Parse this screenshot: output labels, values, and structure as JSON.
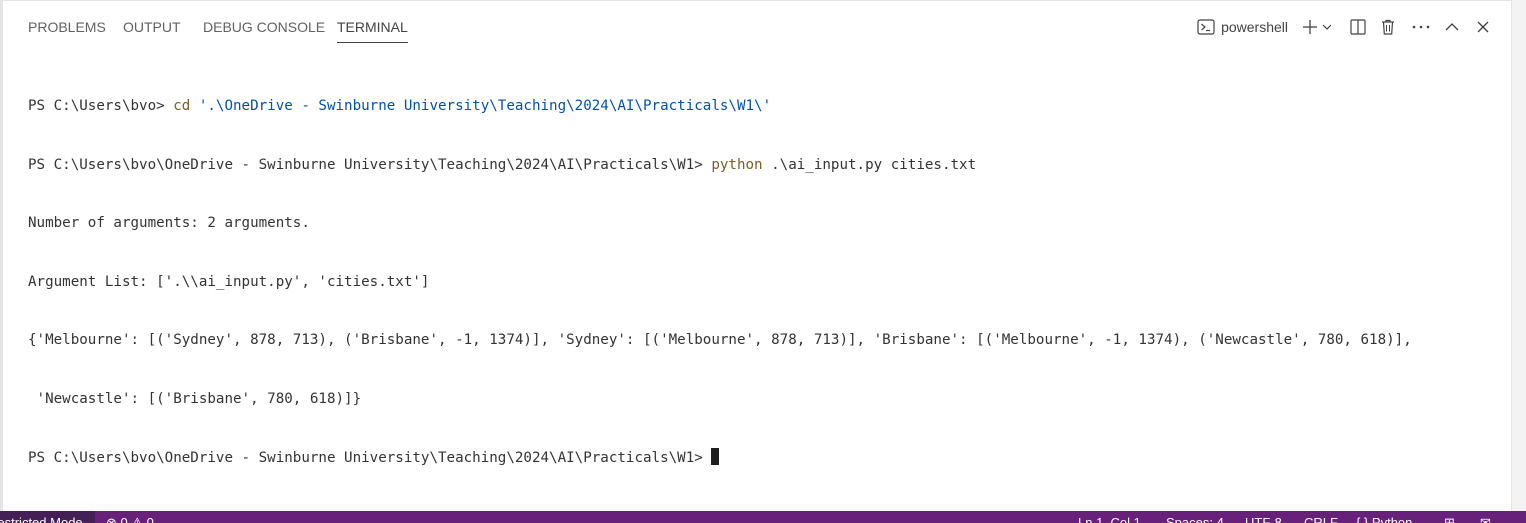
{
  "panel": {
    "tabs": [
      {
        "label": "PROBLEMS"
      },
      {
        "label": "OUTPUT"
      },
      {
        "label": "DEBUG CONSOLE"
      },
      {
        "label": "TERMINAL"
      }
    ],
    "active_tab": "TERMINAL",
    "terminal_name": "powershell",
    "icons": [
      "terminal-icon",
      "plus-icon",
      "chevron-down-icon",
      "split-icon",
      "trash-icon",
      "more-icon",
      "chevron-up-icon",
      "close-icon"
    ]
  },
  "terminal": {
    "line1_prompt": "PS C:\\Users\\bvo> ",
    "line1_cmd": "cd",
    "line1_arg": " '.\\OneDrive - Swinburne University\\Teaching\\2024\\AI\\Practicals\\W1\\'",
    "line2_prompt": "PS C:\\Users\\bvo\\OneDrive - Swinburne University\\Teaching\\2024\\AI\\Practicals\\W1> ",
    "line2_cmd": "python",
    "line2_arg": " .\\ai_input.py cities.txt",
    "line3": "Number of arguments: 2 arguments.",
    "line4": "Argument List: ['.\\\\ai_input.py', 'cities.txt']",
    "line5": "{'Melbourne': [('Sydney', 878, 713), ('Brisbane', -1, 1374)], 'Sydney': [('Melbourne', 878, 713)], 'Brisbane': [('Melbourne', -1, 1374), ('Newcastle', 780, 618)],",
    "line6": " 'Newcastle': [('Brisbane', 780, 618)]}",
    "line7_prompt": "PS C:\\Users\\bvo\\OneDrive - Swinburne University\\Teaching\\2024\\AI\\Practicals\\W1> "
  },
  "statusbar": {
    "restricted_label": "Restricted Mode",
    "problems_label": "⊗ 0 ⚠ 0",
    "position": "Ln 1, Col 1",
    "spaces": "Spaces: 4",
    "encoding": "UTF-8",
    "eol": "CRLF",
    "language": "{ } Python"
  },
  "colors": {
    "statusbar": "#68217a",
    "restricted": "#452056",
    "command": "#795e26",
    "string": "#0451a5"
  }
}
